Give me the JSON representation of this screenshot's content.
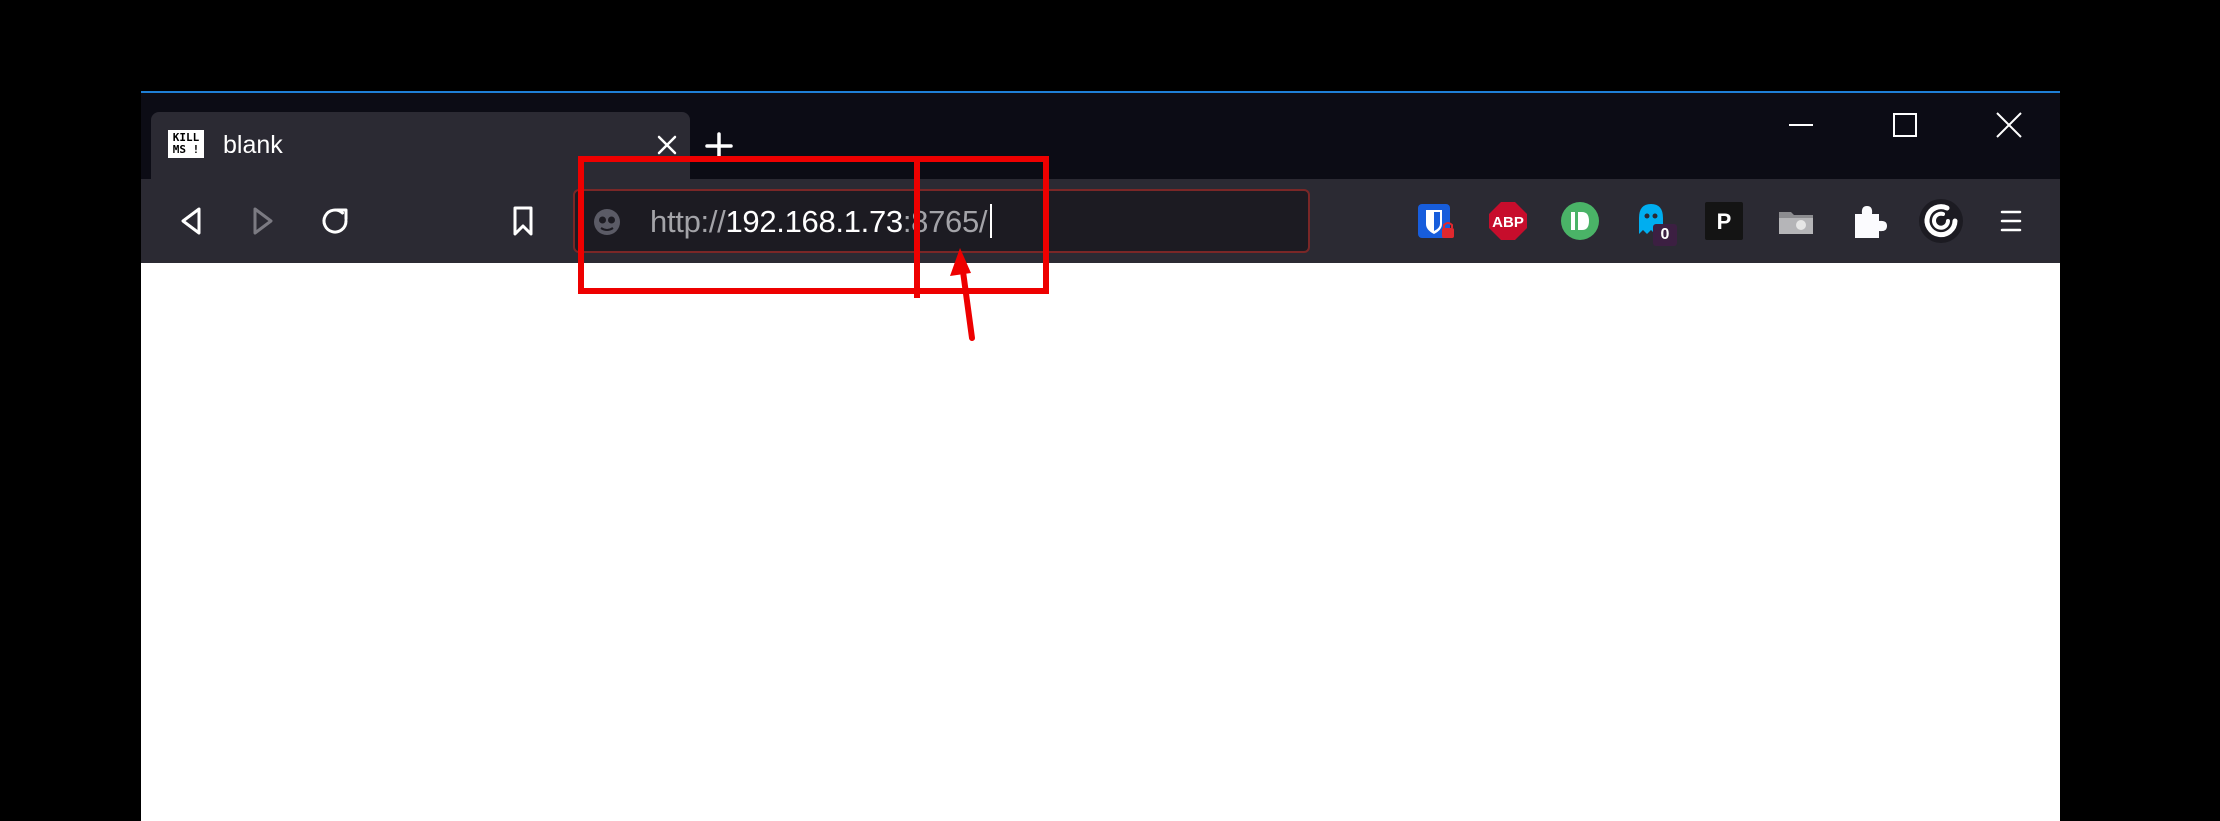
{
  "browser": {
    "tab": {
      "favicon_text": "KILL\nMS !",
      "title": "blank",
      "close_icon": "close-icon"
    },
    "new_tab_icon": "plus-icon",
    "window_controls": [
      "minimize-icon",
      "maximize-icon",
      "close-icon"
    ],
    "nav": {
      "back_icon": "back-arrow-icon",
      "forward_icon": "forward-arrow-icon",
      "reload_icon": "reload-icon",
      "bookmark_icon": "bookmark-icon"
    },
    "url": {
      "scheme": "http://",
      "host": "192.168.1.73",
      "rest": ":8765/"
    },
    "extensions": [
      {
        "name": "bitwarden-icon"
      },
      {
        "name": "adblock-plus-icon",
        "label": "ABP"
      },
      {
        "name": "pushbullet-icon"
      },
      {
        "name": "ghostery-icon",
        "badge": "0"
      },
      {
        "name": "p-extension-icon",
        "label": "P"
      },
      {
        "name": "folder-icon"
      },
      {
        "name": "extensions-puzzle-icon"
      },
      {
        "name": "g-swirl-icon"
      },
      {
        "name": "menu-hamburger-icon"
      }
    ]
  },
  "colors": {
    "titlebar": "#0c0c15",
    "toolbar": "#2b2a33",
    "urlbar": "#1c1b22",
    "annotation": "#ee0000"
  }
}
